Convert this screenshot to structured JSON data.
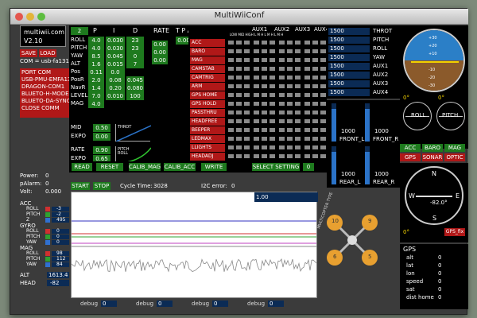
{
  "window": {
    "title": "MultiWiiConf"
  },
  "header": {
    "site": "multiwii.com",
    "version": "V2.10"
  },
  "buttons": {
    "save": "SAVE",
    "load": "LOAD",
    "start": "START",
    "stop": "STOP"
  },
  "com": {
    "label": "COM = usb-fa131",
    "title": "PORT COM",
    "ports": [
      "USB-PMU-EMFA131",
      "DRAGON-COM1",
      "BLUETO-H-MODEM",
      "BLUETO-DA-SYNC"
    ],
    "close": "CLOSE COMM"
  },
  "pid": {
    "headers": [
      "P",
      "I",
      "D",
      "RATE",
      "T P A"
    ],
    "top_value": "2",
    "tpa_value": "0.00",
    "rows": [
      {
        "name": "ROLL",
        "p": "4.0",
        "i": "0.030",
        "d": "23",
        "rate": "0.00"
      },
      {
        "name": "PITCH",
        "p": "4.0",
        "i": "0.030",
        "d": "23",
        "rate": "0.00"
      },
      {
        "name": "YAW",
        "p": "8.5",
        "i": "0.045",
        "d": "0",
        "rate": "0.00"
      },
      {
        "name": "ALT",
        "p": "1.6",
        "i": "0.015",
        "d": "7",
        "rate": ""
      },
      {
        "name": "Pos",
        "p": "0.11",
        "i": "0.0",
        "d": "",
        "rate": ""
      },
      {
        "name": "PosR",
        "p": "2.0",
        "i": "0.08",
        "d": "0.045",
        "rate": ""
      },
      {
        "name": "NavR",
        "p": "1.4",
        "i": "0.20",
        "d": "0.080",
        "rate": ""
      },
      {
        "name": "LEVEL",
        "p": "7.0",
        "i": "0.010",
        "d": "100",
        "rate": ""
      },
      {
        "name": "MAG",
        "p": "4.0",
        "i": "",
        "d": "",
        "rate": ""
      }
    ],
    "expo": [
      {
        "name": "MID",
        "value": "0.50"
      },
      {
        "name": "EXPO",
        "value": "0.00"
      },
      {
        "name": "RATE",
        "value": "0.90"
      },
      {
        "name": "EXPO",
        "value": "0.65"
      }
    ],
    "curve_labels": {
      "throttle": "THROT",
      "pitch_roll": "PITCH ROLL"
    }
  },
  "actions": {
    "read": "READ",
    "reset": "RESET",
    "calib_mag": "CALIB_MAG",
    "calib_acc": "CALIB_ACC",
    "write": "WRITE",
    "select_setting": "SELECT SETTING",
    "setting_value": "0"
  },
  "aux": {
    "columns": [
      "AUX1",
      "AUX2",
      "AUX3",
      "AUX4"
    ],
    "subheads": "LOW MID HIGH  L  M  H  L  M  H  L  M  H",
    "boxes": [
      "ACC",
      "BARO",
      "MAG",
      "CAMSTAB",
      "CAMTRIG",
      "ARM",
      "GPS HOME",
      "GPS HOLD",
      "PASSTHRU",
      "HEADFREE",
      "BEEPER",
      "LEDMAX",
      "LLIGHTS",
      "HEADADJ"
    ]
  },
  "rc": [
    {
      "value": "1500",
      "name": "THROT"
    },
    {
      "value": "1500",
      "name": "PITCH"
    },
    {
      "value": "1500",
      "name": "ROLL"
    },
    {
      "value": "1500",
      "name": "YAW"
    },
    {
      "value": "1500",
      "name": "AUX1"
    },
    {
      "value": "1500",
      "name": "AUX2"
    },
    {
      "value": "1500",
      "name": "AUX3"
    },
    {
      "value": "1500",
      "name": "AUX4"
    }
  ],
  "motors": [
    {
      "value": "1000",
      "name": "FRONT_L",
      "level": 0.85
    },
    {
      "value": "1000",
      "name": "FRONT_R",
      "level": 0.85
    },
    {
      "value": "1000",
      "name": "REAR_L",
      "level": 0.85
    },
    {
      "value": "1000",
      "name": "REAR_R",
      "level": 0.85
    }
  ],
  "horizon": {
    "ticks": [
      "+30",
      "+20",
      "+10",
      "-10",
      "-20",
      "-30"
    ],
    "roll_label": "ROLL",
    "pitch_label": "PITCH",
    "roll_value": "0°",
    "pitch_value": "0°"
  },
  "sensors": {
    "row1": [
      "ACC",
      "BARO",
      "MAG"
    ],
    "row2": [
      "GPS",
      "SONAR",
      "OPTIC"
    ]
  },
  "compass": {
    "heading": "-82.0°",
    "n": "N",
    "s": "S",
    "e": "E",
    "w": "W",
    "bottom_value": "0°",
    "gps_fix": "GPS_fix"
  },
  "status": {
    "cycle_time_label": "Cycle Time:",
    "cycle_time": "3028",
    "i2c_label": "I2C error:",
    "i2c": "0"
  },
  "power": {
    "power_label": "Power:",
    "power": "0",
    "palarm_label": "pAlarm:",
    "palarm": "0",
    "volt_label": "Volt:",
    "volt": "0.000"
  },
  "graph": {
    "scale": "1.00"
  },
  "sensor_values": {
    "acc": {
      "label": "ACC",
      "rows": [
        {
          "name": "ROLL",
          "value": "-3"
        },
        {
          "name": "PITCH",
          "value": "-2"
        },
        {
          "name": "Z",
          "value": "495"
        }
      ]
    },
    "gyro": {
      "label": "GYRO",
      "rows": [
        {
          "name": "ROLL",
          "value": "0"
        },
        {
          "name": "PITCH",
          "value": "0"
        },
        {
          "name": "YAW",
          "value": "0"
        }
      ]
    },
    "mag": {
      "label": "MAG",
      "rows": [
        {
          "name": "ROLL",
          "value": "98"
        },
        {
          "name": "PITCH",
          "value": "112"
        },
        {
          "name": "YAW",
          "value": "84"
        }
      ]
    },
    "alt": {
      "label": "ALT",
      "value": "1613.4"
    },
    "head": {
      "label": "HEAD",
      "value": "-82"
    }
  },
  "debug": [
    {
      "label": "debug",
      "value": "0"
    },
    {
      "label": "debug",
      "value": "0"
    },
    {
      "label": "debug",
      "value": "0"
    },
    {
      "label": "debug",
      "value": "0"
    }
  ],
  "quad": {
    "label": "MULTICOPTER TYPE",
    "motors": [
      "10",
      "9",
      "6",
      "5"
    ]
  },
  "gps": {
    "title": "GPS",
    "rows": [
      {
        "name": "alt",
        "value": "0"
      },
      {
        "name": "lat",
        "value": "0"
      },
      {
        "name": "lon",
        "value": "0"
      },
      {
        "name": "speed",
        "value": "0"
      },
      {
        "name": "sat",
        "value": "0"
      },
      {
        "name": "dist home",
        "value": "0"
      }
    ]
  },
  "colors": {
    "bg": "#3b3b3b",
    "green": "#1e7a1e",
    "red": "#b01818",
    "blue": "#2b73c8",
    "dark_blue": "#0b2b55"
  }
}
